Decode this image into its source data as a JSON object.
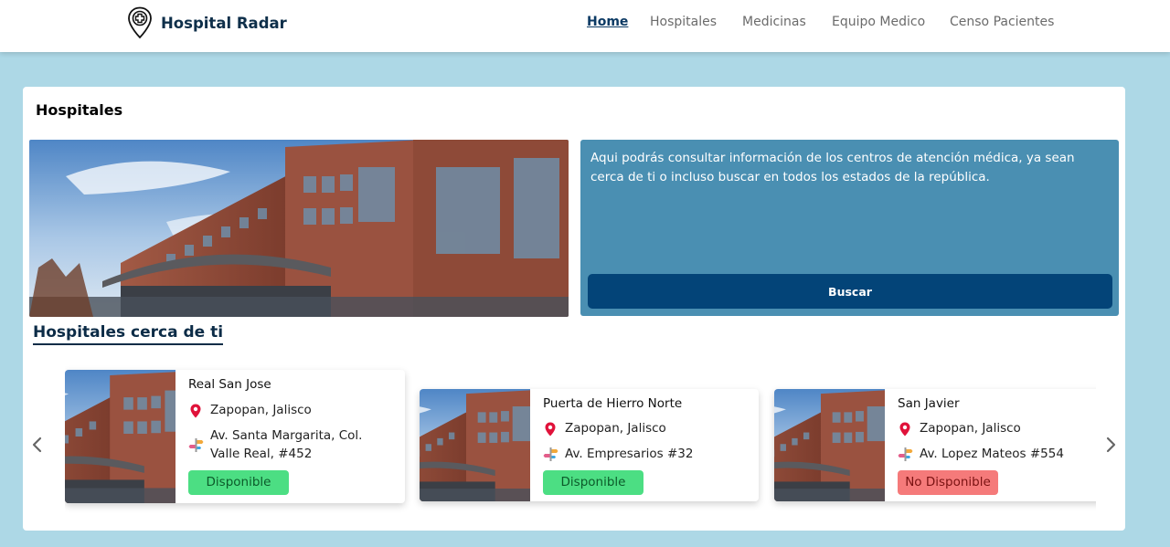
{
  "brand": {
    "name": "Hospital Radar"
  },
  "nav": {
    "items": [
      {
        "label": "Home",
        "active": true
      },
      {
        "label": "Hospitales",
        "active": false
      },
      {
        "label": "Medicinas",
        "active": false
      },
      {
        "label": "Equipo Medico",
        "active": false
      },
      {
        "label": "Censo Pacientes",
        "active": false
      }
    ]
  },
  "panel": {
    "title": "Hospitales",
    "info_text": "Aqui podrás consultar información de los centros de atención médica, ya sean cerca de ti o incluso buscar en todos los estados de la república.",
    "search_button": "Buscar"
  },
  "nearby": {
    "title": "Hospitales cerca de ti",
    "cards": [
      {
        "name": "Real San Jose",
        "location": "Zapopan, Jalisco",
        "address": "Av. Santa Margarita, Col. Valle Real, #452",
        "status": "Disponible",
        "available": true
      },
      {
        "name": "Puerta de Hierro Norte",
        "location": "Zapopan, Jalisco",
        "address": "Av. Empresarios #32",
        "status": "Disponible",
        "available": true
      },
      {
        "name": "San Javier",
        "location": "Zapopan, Jalisco",
        "address": "Av. Lopez Mateos #554",
        "status": "No Disponible",
        "available": false
      }
    ]
  },
  "colors": {
    "page_bg": "#add8e6",
    "brand_navy": "#0e2f4a",
    "info_box": "#4a8fb2",
    "button": "#034478",
    "available": "#4cde83",
    "unavailable": "#f57a7a"
  },
  "icons": {
    "brand": "hospital-pin-icon",
    "location": "map-pin-icon",
    "address": "directions-icon",
    "prev": "chevron-left-icon",
    "next": "chevron-right-icon"
  }
}
